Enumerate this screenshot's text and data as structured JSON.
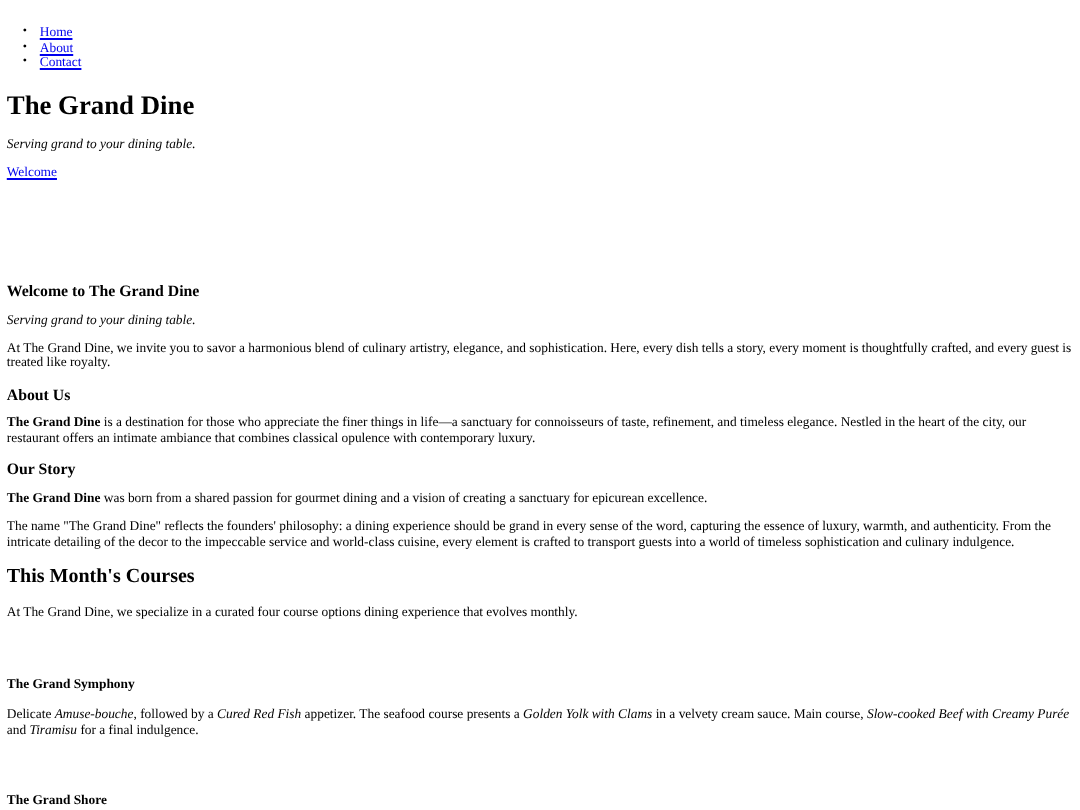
{
  "nav": {
    "items": [
      {
        "marker": "•",
        "label": "Home"
      },
      {
        "marker": "•",
        "label": "About"
      },
      {
        "marker": "•",
        "label": "Contact"
      }
    ]
  },
  "header": {
    "title": "The Grand Dine",
    "tagline": "Serving grand to your dining table.",
    "link": "Welcome"
  },
  "content": [
    {
      "kind": "h3",
      "text": "Welcome to The Grand Dine"
    },
    {
      "kind": "tagline",
      "text": "Serving grand to your dining table."
    },
    {
      "kind": "p",
      "text": "At The Grand Dine, we invite you to savor a harmonious blend of culinary artistry, elegance, and sophistication. Here, every dish tells a story, every moment is thoughtfully crafted, and every guest is treated like royalty."
    },
    {
      "kind": "h3",
      "text": "About Us"
    },
    {
      "kind": "p",
      "text": "**The Grand Dine** is a destination for those who appreciate the finer things in life—a sanctuary for connoisseurs of taste, refinement, and timeless elegance. Nestled in the heart of the city, our restaurant offers an intimate ambiance that combines classical opulence with contemporary luxury."
    },
    {
      "kind": "h3",
      "text": "Our Story"
    },
    {
      "kind": "p",
      "text": "**The Grand Dine** was born from a shared passion for gourmet dining and a vision of creating a sanctuary for epicurean excellence."
    },
    {
      "kind": "p",
      "text": "The name \"The Grand Dine\" reflects the founders' philosophy: a dining experience should be grand in every sense of the word, capturing the essence of luxury, warmth, and authenticity. From the intricate detailing of the decor to the impeccable service and world-class cuisine, every element is crafted to transport guests into a world of timeless sophistication and culinary indulgence."
    },
    {
      "kind": "h2",
      "text": "This Month's Courses"
    },
    {
      "kind": "p",
      "text": "At The Grand Dine, we specialize in a curated four course options dining experience that evolves monthly."
    },
    {
      "kind": "h4",
      "text": "The Grand Symphony"
    },
    {
      "kind": "p",
      "text": "Delicate *Amuse-bouche*, followed by a *Cured Red Fish* appetizer. The seafood course presents a *Golden Yolk with Clams* in a velvety cream sauce. Main course, *Slow-cooked Beef with Creamy Purée* and *Tiramisu* for a final indulgence."
    },
    {
      "kind": "h4",
      "text": "The Grand Shore"
    }
  ]
}
